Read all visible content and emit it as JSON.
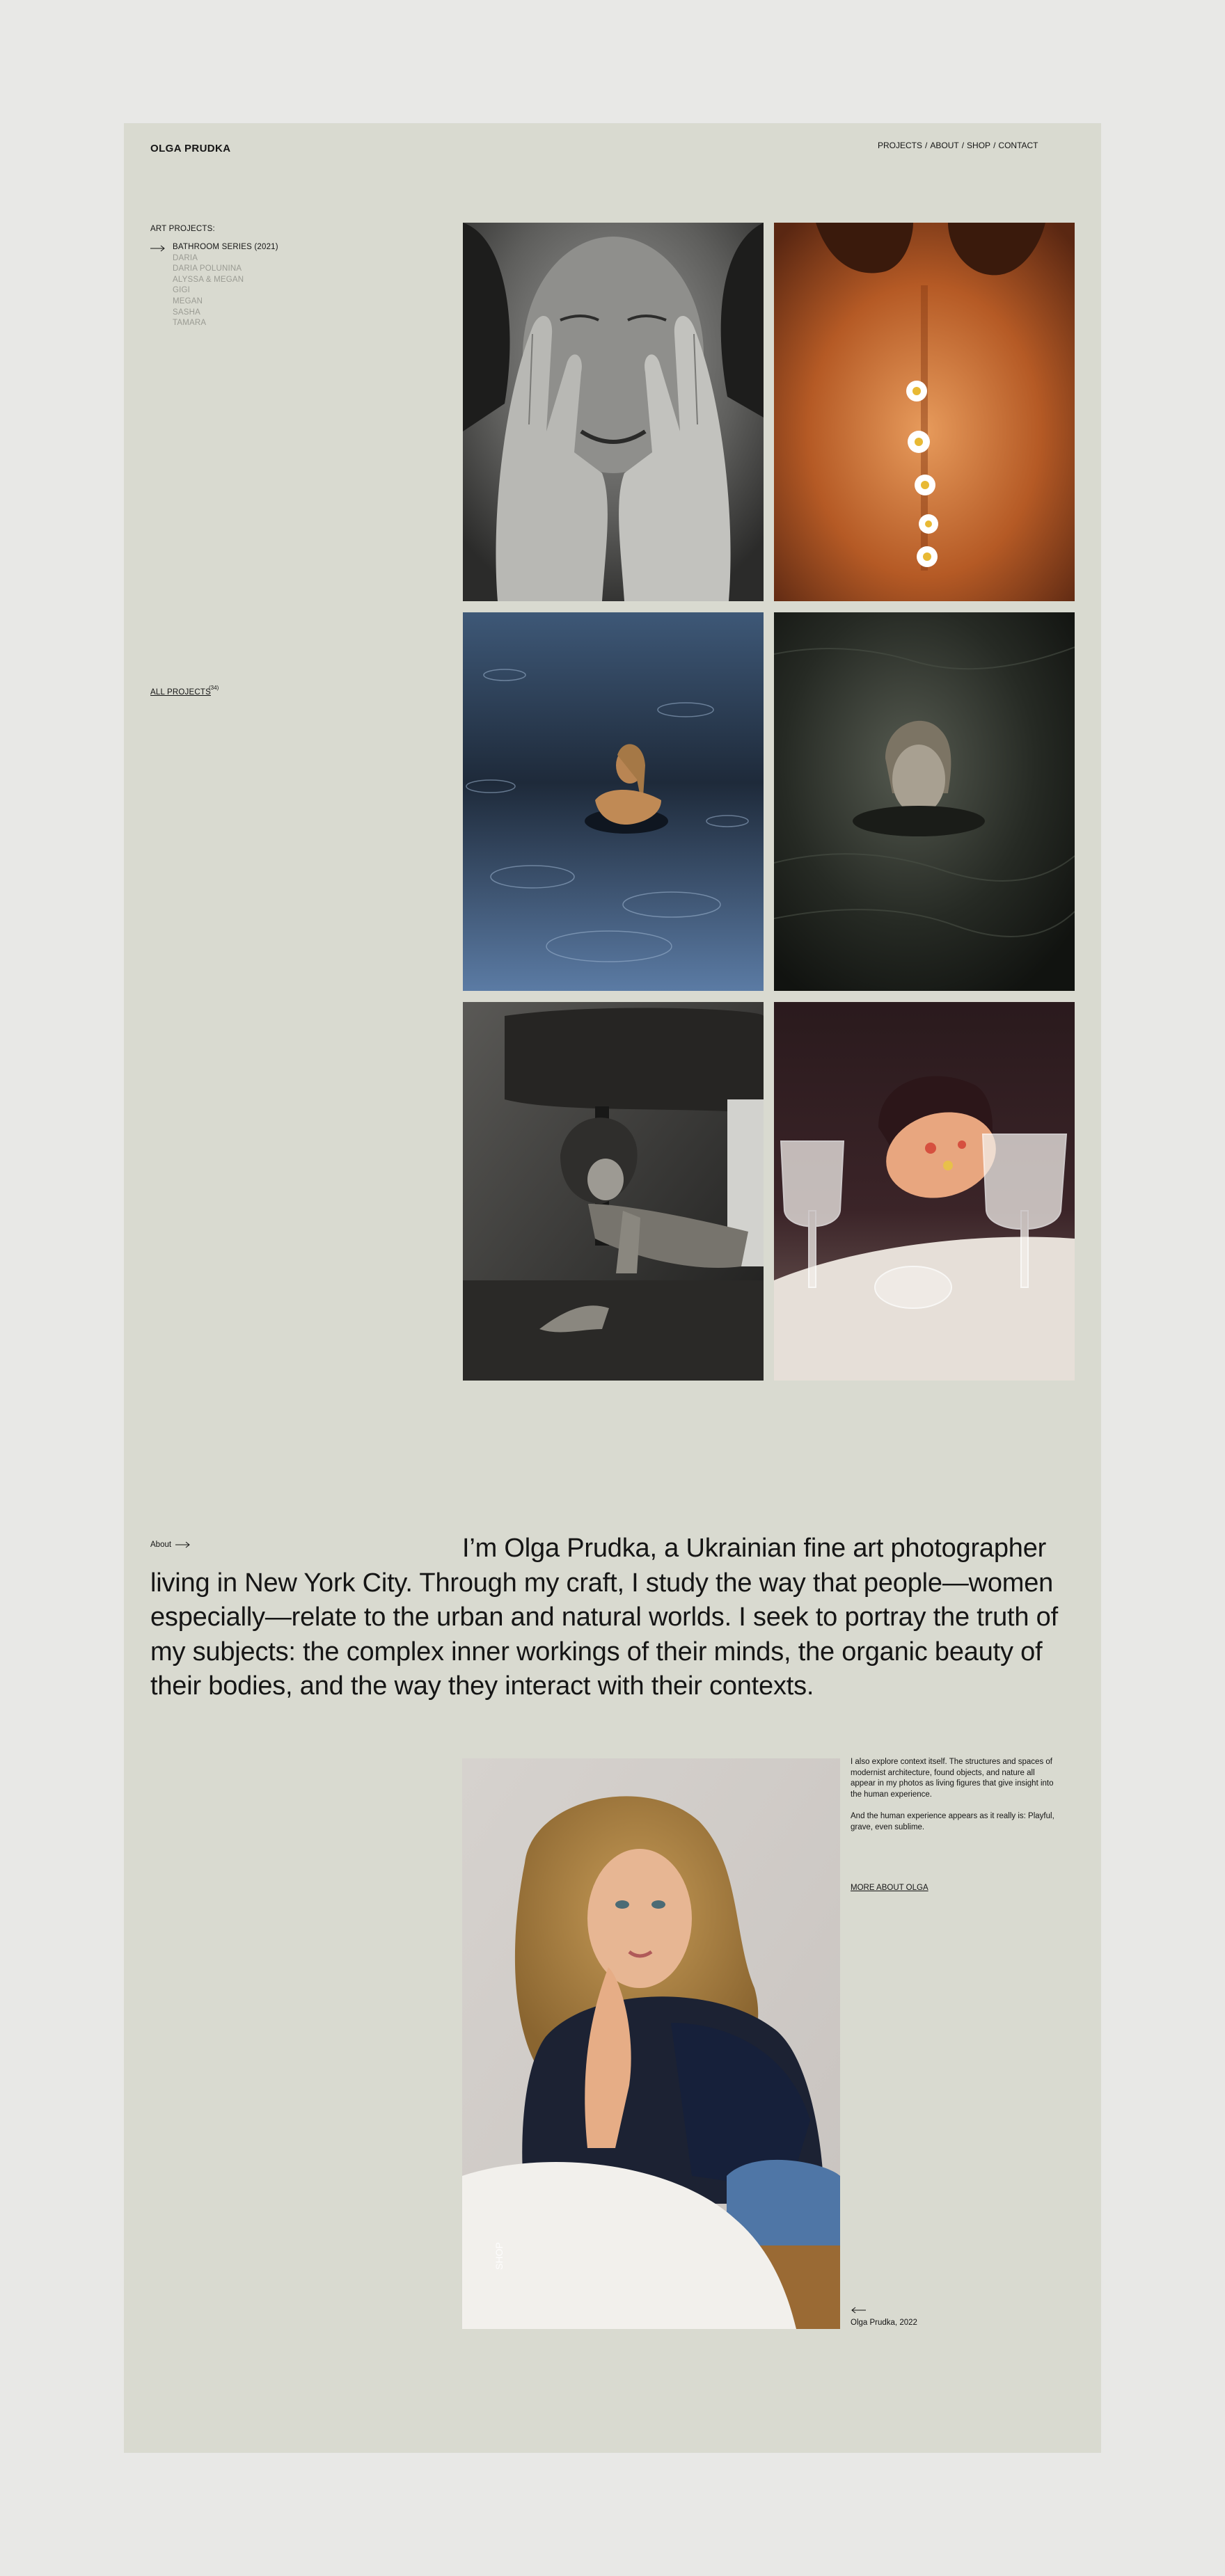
{
  "header": {
    "logo": "OLGA PRUDKA",
    "nav": [
      {
        "label": "PROJECTS"
      },
      {
        "label": "ABOUT"
      },
      {
        "label": "SHOP"
      },
      {
        "label": "CONTACT"
      }
    ],
    "separator": "/"
  },
  "sidebar": {
    "title": "ART PROJECTS:",
    "items": [
      {
        "label": "BATHROOM SERIES (2021)",
        "active": true
      },
      {
        "label": "DARIA"
      },
      {
        "label": "DARIA POLUNINA"
      },
      {
        "label": "ALYSSA & MEGAN"
      },
      {
        "label": "GIGI"
      },
      {
        "label": "MEGAN"
      },
      {
        "label": "SASHA"
      },
      {
        "label": "TAMARA"
      }
    ],
    "all_projects": "ALL PROJECTS",
    "all_projects_count": "(34)"
  },
  "gallery": {
    "photos": [
      {
        "name": "hands-on-face"
      },
      {
        "name": "daisies-on-back"
      },
      {
        "name": "woman-in-blue-water"
      },
      {
        "name": "woman-in-dark-water"
      },
      {
        "name": "woman-under-table"
      },
      {
        "name": "woman-with-glasses"
      }
    ]
  },
  "about": {
    "link_label": "About",
    "intro": "I’m Olga Prudka, a Ukrainian fine art photographer living in New York City. Through my craft, I study the way that people—women especially—relate to the urban and natural worlds. I seek to portray the truth of my subjects: the complex inner workings of their minds, the organic beauty of their bodies, and the way they interact with their contexts.",
    "paragraph1": "I also explore context itself. The structures and spaces of modernist architecture, found objects, and nature all appear in my photos as living figures that give insight into the human experience.",
    "paragraph2": "And the human experience appears as it really is: Playful, grave, even sublime.",
    "more_link": "MORE ABOUT OLGA",
    "caption": "Olga Prudka, 2022"
  },
  "colors": {
    "page_bg": "#e8e8e6",
    "frame_bg": "#d9dad0",
    "text": "#151515",
    "muted": "#9a9b93"
  }
}
